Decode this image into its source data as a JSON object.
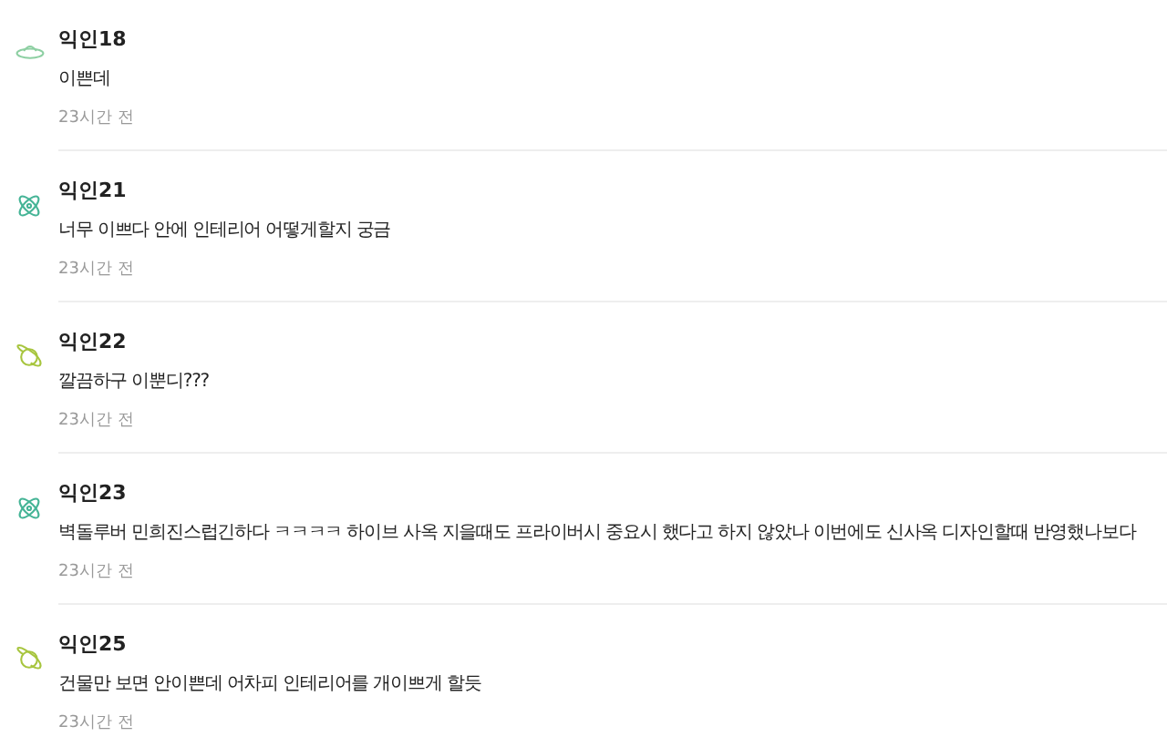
{
  "comments": [
    {
      "kind": "ufo",
      "author": "익인18",
      "text": "이쁜데",
      "time": "23시간 전"
    },
    {
      "kind": "atom",
      "author": "익인21",
      "text": "너무 이쁘다 안에 인테리어 어떻게할지 궁금",
      "time": "23시간 전"
    },
    {
      "kind": "planet",
      "author": "익인22",
      "text": "깔끔하구 이뿐디???",
      "time": "23시간 전"
    },
    {
      "kind": "atom",
      "author": "익인23",
      "text": "벽돌루버 민희진스럽긴하다 ㅋㅋㅋㅋ 하이브 사옥 지을때도 프라이버시 중요시 했다고 하지 않았나 이번에도 신사옥 디자인할때 반영했나보다",
      "time": "23시간 전"
    },
    {
      "kind": "planet",
      "author": "익인25",
      "text": "건물만 보면 안이쁜데 어차피 인테리어를 개이쁘게 할듯",
      "time": "23시간 전"
    }
  ]
}
